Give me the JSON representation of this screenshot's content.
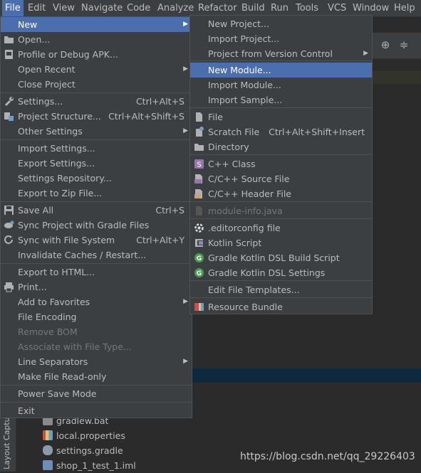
{
  "menubar": {
    "items": [
      "File",
      "Edit",
      "View",
      "Navigate",
      "Code",
      "Analyze",
      "Refactor",
      "Build",
      "Run",
      "Tools",
      "VCS",
      "Window",
      "Help"
    ]
  },
  "file_menu": {
    "items": [
      {
        "label": "New",
        "shortcut": "",
        "submenu": true,
        "selected": true
      },
      {
        "label": "Open...",
        "shortcut": "",
        "icon": "folder-open-icon"
      },
      {
        "label": "Profile or Debug APK...",
        "shortcut": "",
        "icon": "apk-icon"
      },
      {
        "label": "Open Recent",
        "shortcut": "",
        "submenu": true
      },
      {
        "label": "Close Project",
        "shortcut": ""
      },
      {
        "label": "Settings...",
        "shortcut": "Ctrl+Alt+S",
        "icon": "wrench-icon"
      },
      {
        "label": "Project Structure...",
        "shortcut": "Ctrl+Alt+Shift+S",
        "icon": "project-structure-icon"
      },
      {
        "label": "Other Settings",
        "shortcut": "",
        "submenu": true
      },
      {
        "label": "Import Settings...",
        "shortcut": ""
      },
      {
        "label": "Export Settings...",
        "shortcut": ""
      },
      {
        "label": "Settings Repository...",
        "shortcut": ""
      },
      {
        "label": "Export to Zip File...",
        "shortcut": ""
      },
      {
        "label": "Save All",
        "shortcut": "Ctrl+S",
        "icon": "save-icon"
      },
      {
        "label": "Sync Project with Gradle Files",
        "shortcut": "",
        "icon": "gradle-sync-icon"
      },
      {
        "label": "Sync with File System",
        "shortcut": "Ctrl+Alt+Y",
        "icon": "refresh-icon"
      },
      {
        "label": "Invalidate Caches / Restart...",
        "shortcut": ""
      },
      {
        "label": "Export to HTML...",
        "shortcut": ""
      },
      {
        "label": "Print...",
        "shortcut": "",
        "icon": "printer-icon"
      },
      {
        "label": "Add to Favorites",
        "shortcut": "",
        "submenu": true
      },
      {
        "label": "File Encoding",
        "shortcut": ""
      },
      {
        "label": "Remove BOM",
        "shortcut": "",
        "disabled": true
      },
      {
        "label": "Associate with File Type...",
        "shortcut": "",
        "disabled": true
      },
      {
        "label": "Line Separators",
        "shortcut": "",
        "submenu": true
      },
      {
        "label": "Make File Read-only",
        "shortcut": ""
      },
      {
        "label": "Power Save Mode",
        "shortcut": ""
      },
      {
        "label": "Exit",
        "shortcut": ""
      }
    ]
  },
  "new_submenu": {
    "items": [
      {
        "label": "New Project...",
        "shortcut": ""
      },
      {
        "label": "Import Project...",
        "shortcut": ""
      },
      {
        "label": "Project from Version Control",
        "shortcut": "",
        "submenu": true
      },
      {
        "label": "New Module...",
        "shortcut": "",
        "selected": true
      },
      {
        "label": "Import Module...",
        "shortcut": ""
      },
      {
        "label": "Import Sample...",
        "shortcut": ""
      },
      {
        "label": "File",
        "shortcut": "",
        "icon": "file-icon"
      },
      {
        "label": "Scratch File",
        "shortcut": "Ctrl+Alt+Shift+Insert",
        "icon": "scratch-file-icon"
      },
      {
        "label": "Directory",
        "shortcut": "",
        "icon": "directory-icon"
      },
      {
        "label": "C++ Class",
        "shortcut": "",
        "icon": "cpp-class-icon"
      },
      {
        "label": "C/C++ Source File",
        "shortcut": "",
        "icon": "cpp-source-icon"
      },
      {
        "label": "C/C++ Header File",
        "shortcut": "",
        "icon": "cpp-header-icon"
      },
      {
        "label": "module-info.java",
        "shortcut": "",
        "icon": "java-module-icon",
        "disabled": true
      },
      {
        "label": ".editorconfig file",
        "shortcut": "",
        "icon": "editorconfig-icon"
      },
      {
        "label": "Kotlin Script",
        "shortcut": "",
        "icon": "kotlin-icon"
      },
      {
        "label": "Gradle Kotlin DSL Build Script",
        "shortcut": "",
        "icon": "gradle-icon"
      },
      {
        "label": "Gradle Kotlin DSL Settings",
        "shortcut": "",
        "icon": "gradle-icon"
      },
      {
        "label": "Edit File Templates...",
        "shortcut": ""
      },
      {
        "label": "Resource Bundle",
        "shortcut": "",
        "icon": "resource-bundle-icon"
      }
    ]
  },
  "project_tree": {
    "items": [
      "gradlew.bat",
      "local.properties",
      "settings.gradle",
      "shop_1_test_1.iml"
    ]
  },
  "side_panel": {
    "label": "Layout Captures"
  },
  "watermark": "https://blog.csdn.net/qq_29226403",
  "colors": {
    "selection": "#4b6eaf",
    "menu_bg": "#3c3f41",
    "text": "#bbbbbb",
    "disabled": "#777777",
    "gradle_green": "#499c54",
    "cpp_purple": "#9876aa"
  }
}
